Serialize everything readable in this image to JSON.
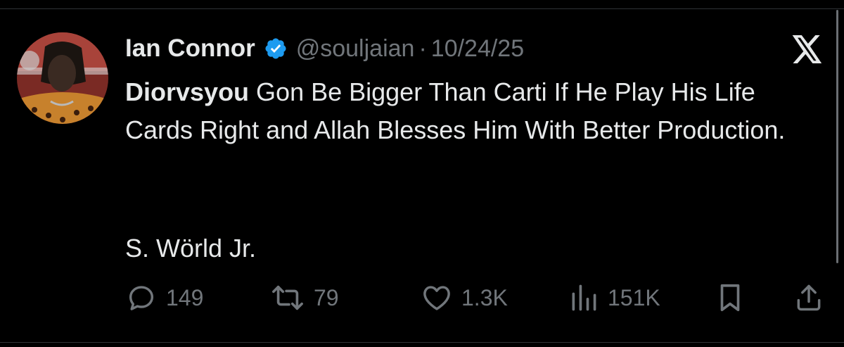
{
  "tweet": {
    "display_name": "Ian Connor",
    "handle": "@souljaian",
    "separator": "·",
    "date": "10/24/25",
    "mention": "Diorvsyou",
    "body": " Gon Be Bigger Than Carti If He Play His Life Cards Right and Allah Blesses Him With Better Production.",
    "signoff": "S. Wörld Jr."
  },
  "actions": {
    "replies": "149",
    "reposts": "79",
    "likes": "1.3K",
    "views": "151K"
  },
  "icons": {
    "verified": "verified-badge-icon",
    "platform": "x-logo-icon",
    "reply": "reply-icon",
    "repost": "repost-icon",
    "like": "heart-icon",
    "views": "views-chart-icon",
    "bookmark": "bookmark-icon",
    "share": "share-icon"
  },
  "colors": {
    "background": "#000000",
    "text": "#e7e9ea",
    "muted": "#71767b",
    "verified": "#1d9bf0"
  }
}
